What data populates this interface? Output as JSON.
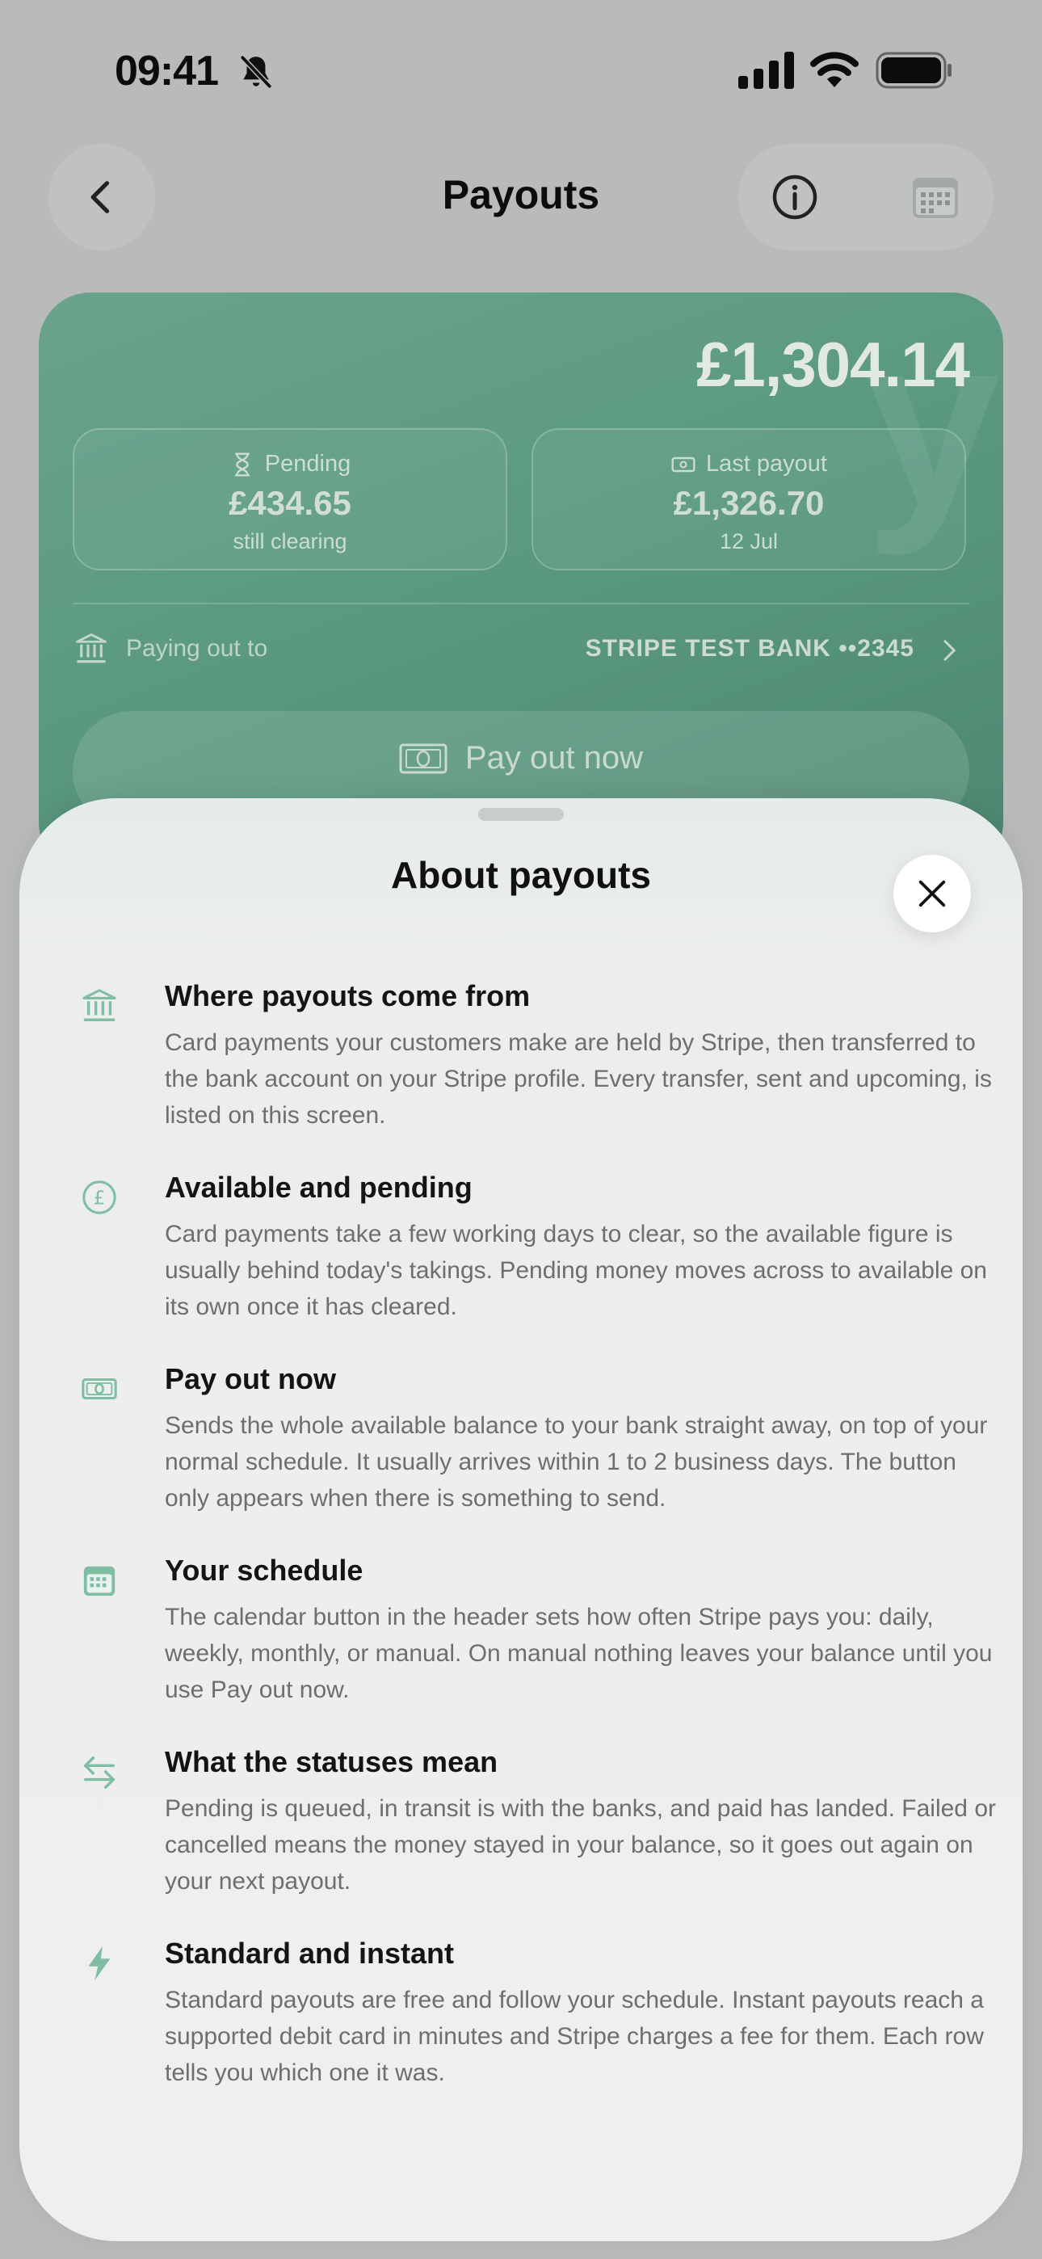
{
  "status_bar": {
    "time": "09:41",
    "icons": [
      "bell-slash-icon",
      "cellular-signal-icon",
      "wifi-icon",
      "battery-icon"
    ]
  },
  "header": {
    "title": "Payouts",
    "back_icon": "chevron-left-icon",
    "info_icon": "info-icon",
    "calendar_icon": "calendar-icon"
  },
  "balance_card": {
    "available_amount": "£1,304.14",
    "pending": {
      "label": "Pending",
      "amount": "£434.65",
      "note": "still clearing",
      "icon": "hourglass-icon"
    },
    "last_payout": {
      "label": "Last payout",
      "amount": "£1,326.70",
      "date": "12 Jul",
      "icon": "banknote-icon"
    },
    "paying_out_label": "Paying out to",
    "bank_name": "STRIPE TEST BANK ••2345",
    "payout_button_label": "Pay out now"
  },
  "sheet": {
    "title": "About payouts",
    "close_icon": "close-icon",
    "topics": [
      {
        "icon": "bank-icon",
        "title": "Where payouts come from",
        "body": "Card payments your customers make are held by Stripe, then transferred to the bank account on your Stripe profile. Every transfer, sent and upcoming, is listed on this screen."
      },
      {
        "icon": "pound-coin-icon",
        "title": "Available and pending",
        "body": "Card payments take a few working days to clear, so the available figure is usually behind today's takings. Pending money moves across to available on its own once it has cleared."
      },
      {
        "icon": "banknote-icon",
        "title": "Pay out now",
        "body": "Sends the whole available balance to your bank straight away, on top of your normal schedule. It usually arrives within 1 to 2 business days. The button only appears when there is something to send."
      },
      {
        "icon": "calendar-icon",
        "title": "Your schedule",
        "body": "The calendar button in the header sets how often Stripe pays you: daily, weekly, monthly, or manual. On manual nothing leaves your balance until you use Pay out now."
      },
      {
        "icon": "arrows-swap-icon",
        "title": "What the statuses mean",
        "body": "Pending is queued, in transit is with the banks, and paid has landed. Failed or cancelled means the money stayed in your balance, so it goes out again on your next payout."
      },
      {
        "icon": "lightning-icon",
        "title": "Standard and instant",
        "body": "Standard payouts are free and follow your schedule. Instant payouts reach a supported debit card in minutes and Stripe charges a fee for them. Each row tells you which one it was."
      }
    ]
  },
  "colors": {
    "brand_green": "#5b9a80",
    "icon_green": "#7fbea3",
    "sheet_bg": "#eeefee",
    "page_bg": "#b8bbba"
  }
}
